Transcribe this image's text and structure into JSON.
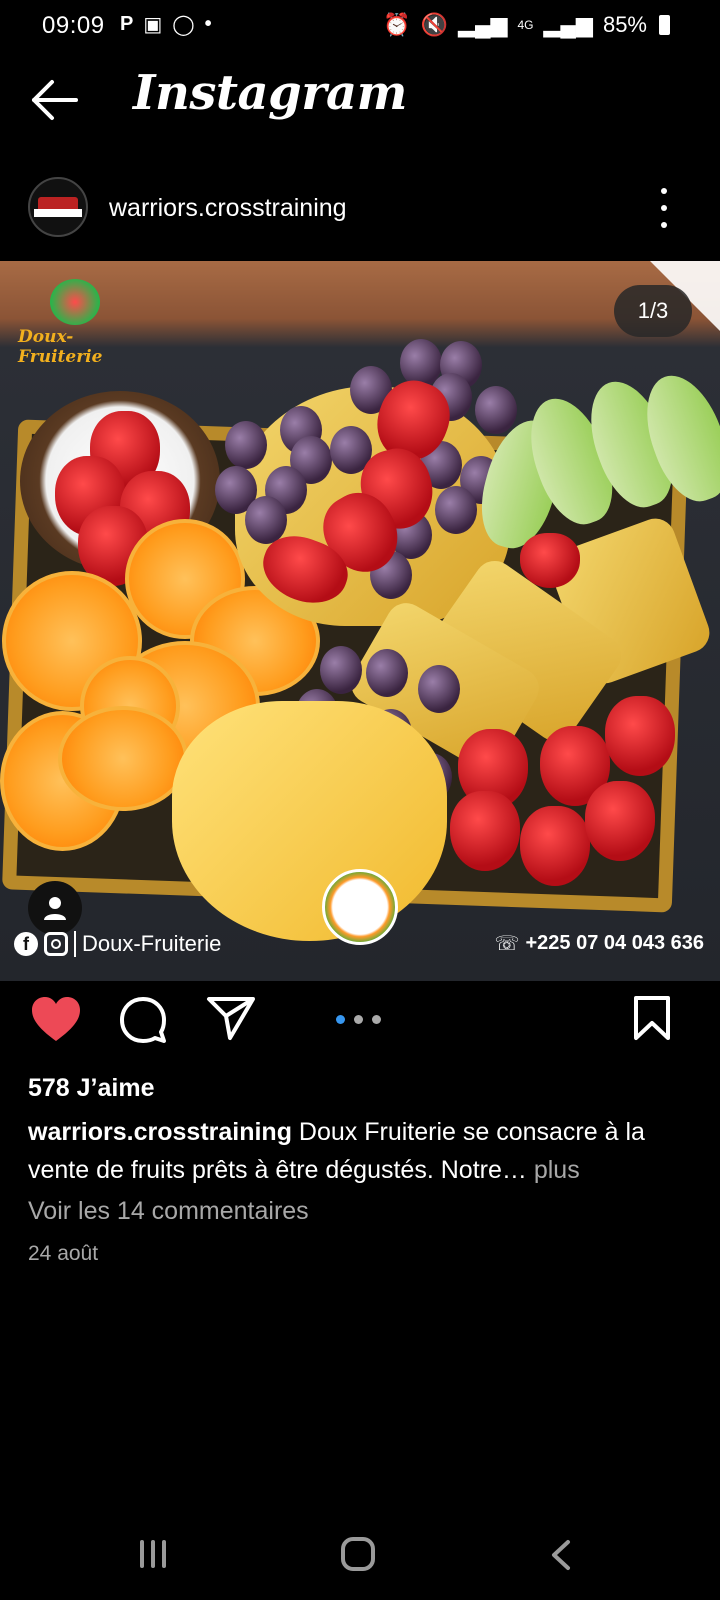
{
  "status_bar": {
    "time": "09:09",
    "left_icons": [
      "parking-icon",
      "gallery-icon",
      "whatsapp-icon",
      "dot-icon"
    ],
    "right_icons": [
      "alarm-icon",
      "mute-icon",
      "signal-icon",
      "4g-icon",
      "signal-icon"
    ],
    "battery": "85%"
  },
  "header": {
    "title": "Instagram"
  },
  "post": {
    "username": "warriors.crosstraining",
    "image_counter": "1/3",
    "image_logo_text": "Doux-Fruiterie",
    "image_watermark_left": "Doux-Fruiterie",
    "image_watermark_phone": "+225 07 04 043 636",
    "carousel_position": 1,
    "carousel_total": 3,
    "likes": "578 J’aime",
    "caption_user": "warriors.crosstraining",
    "caption_text": " Doux Fruiterie se consacre à la vente de fruits prêts à être dégustés. Notre",
    "caption_ellipsis": "… ",
    "caption_more": "plus",
    "comments_link": "Voir les 14 commentaires",
    "date": "24 août"
  },
  "colors": {
    "heart": "#ed4956",
    "active_dot": "#3797f0",
    "secondary_text": "#a8a8a8"
  }
}
